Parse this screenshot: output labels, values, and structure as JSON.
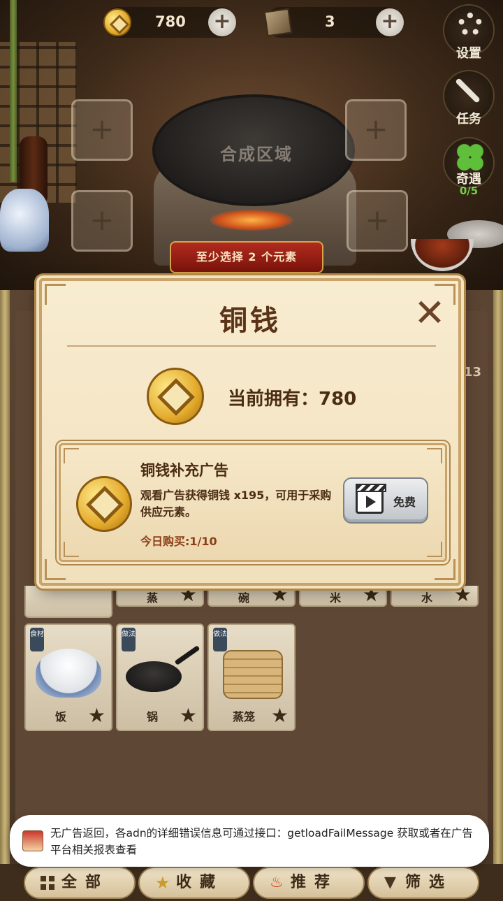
{
  "topbar": {
    "coins": "780",
    "books": "3"
  },
  "side_buttons": {
    "settings_label": "设置",
    "tasks_label": "任务",
    "qiyu_label": "奇遇",
    "qiyu_progress": "0/5"
  },
  "craft": {
    "area_label": "合成区域",
    "hint": "至少选择 2 个元素"
  },
  "inventory": {
    "partial_row": [
      {
        "name": "蒸"
      },
      {
        "name": "碗"
      },
      {
        "name": "米"
      },
      {
        "name": "水"
      }
    ],
    "right_count": "13",
    "items": [
      {
        "tag": "食材",
        "name": "饭"
      },
      {
        "tag": "做法",
        "name": "锅"
      },
      {
        "tag": "做法",
        "name": "蒸笼"
      }
    ]
  },
  "tabs": {
    "all": "全部",
    "favorites": "收藏",
    "recommended": "推荐",
    "filter": "筛选"
  },
  "modal": {
    "title": "铜钱",
    "close": "✕",
    "owned_label": "当前拥有：780",
    "ad": {
      "title": "铜钱补充广告",
      "description": "观看广告获得铜钱 x195，可用于采购供应元素。",
      "daily_limit": "今日购买:1/10",
      "button_label": "免费"
    }
  },
  "toast": {
    "message": "无广告返回，各adn的详细错误信息可通过接口：getloadFailMessage 获取或者在广告平台相关报表查看"
  },
  "colors": {
    "modal_bg": "#f8ecd0",
    "modal_border": "#c9a46a",
    "title_text": "#5a3318",
    "hint_red": "#b22a1e",
    "clover_green": "#6fd24a"
  }
}
